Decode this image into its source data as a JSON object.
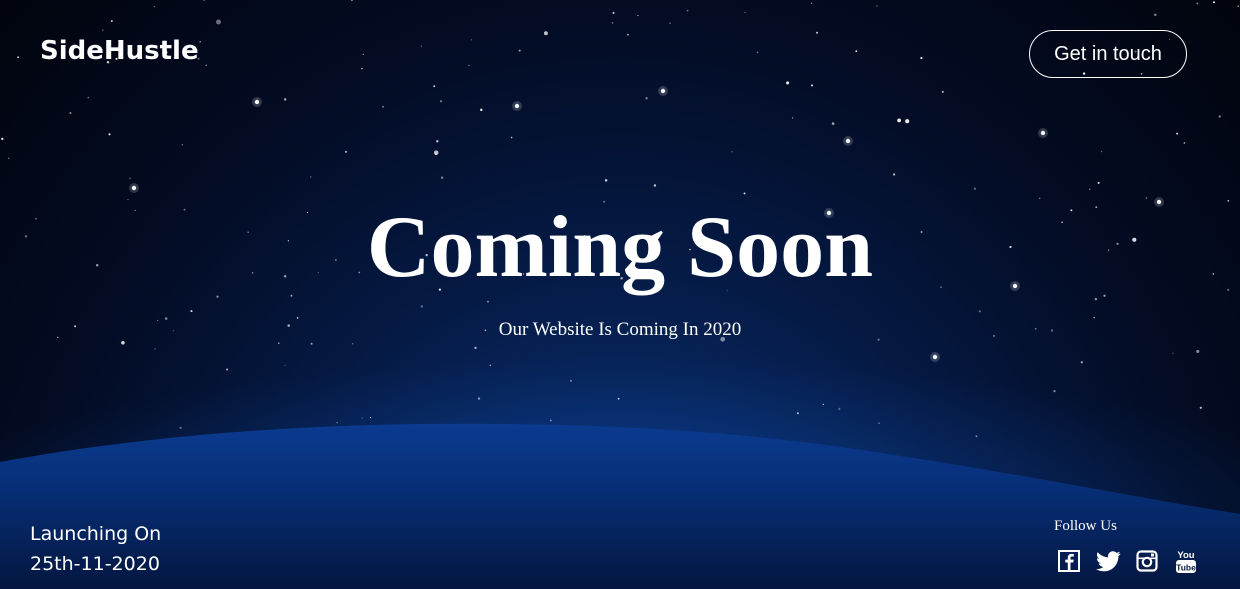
{
  "header": {
    "brand": "SideHustle",
    "contact_label": "Get in touch"
  },
  "hero": {
    "title": "Coming Soon",
    "subtitle": "Our Website Is Coming In 2020"
  },
  "launch": {
    "label": "Launching On",
    "date": "25th-11-2020"
  },
  "social": {
    "label": "Follow Us",
    "icons": [
      "facebook-icon",
      "twitter-icon",
      "instagram-icon",
      "youtube-icon"
    ]
  },
  "colors": {
    "text": "#ffffff",
    "sky_dark": "#01040d",
    "sky_blue": "#0b3a8c"
  }
}
